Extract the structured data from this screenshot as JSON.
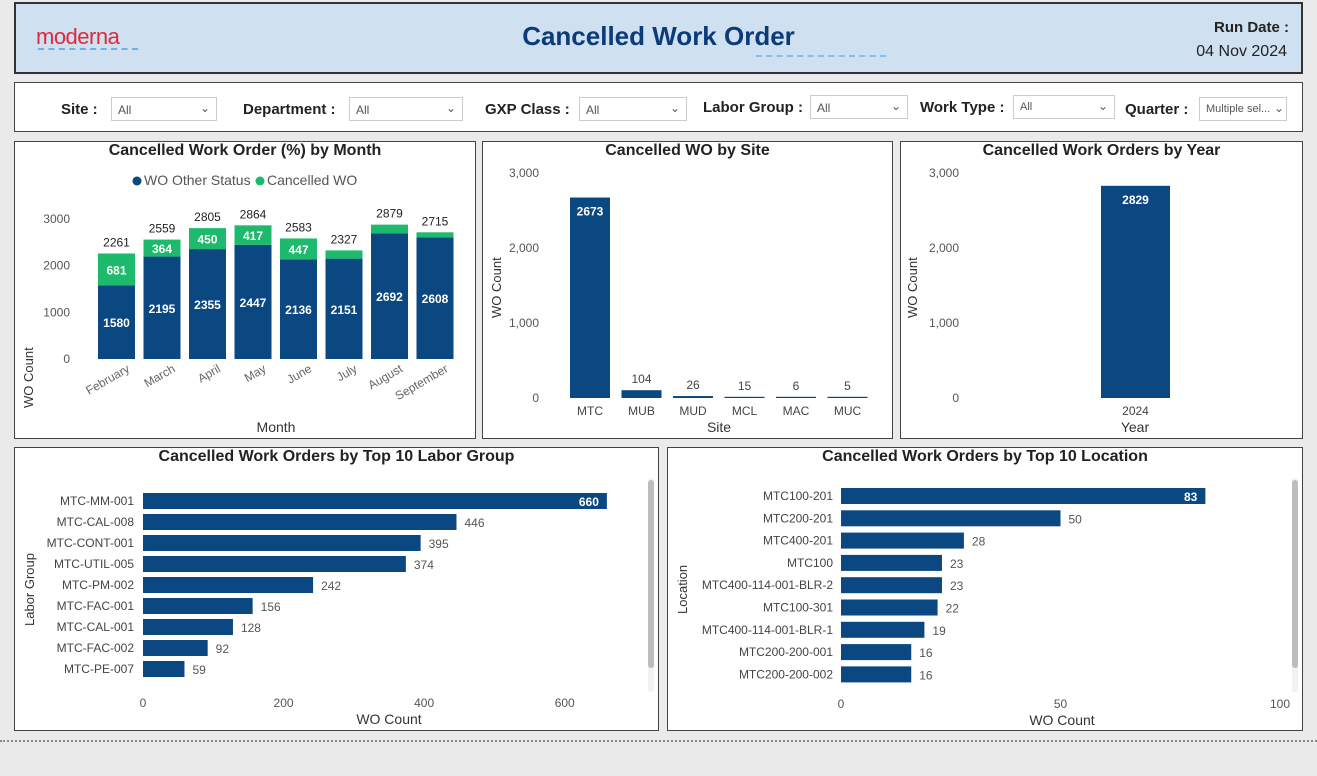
{
  "header": {
    "logo": "moderna",
    "title": "Cancelled Work Order",
    "run_date_label": "Run Date :",
    "run_date_value": "04 Nov 2024"
  },
  "filters": [
    {
      "label": "Site :",
      "value": "All"
    },
    {
      "label": "Department :",
      "value": "All"
    },
    {
      "label": "GXP Class :",
      "value": "All"
    },
    {
      "label": "Labor Group :",
      "value": "All"
    },
    {
      "label": "Work Type :",
      "value": "All"
    },
    {
      "label": "Quarter :",
      "value": "Multiple sel..."
    }
  ],
  "colors": {
    "navy": "#0b4780",
    "green": "#1db96d",
    "header_bg": "#cfe0f0",
    "title": "#0b3b78"
  },
  "chart_data": [
    {
      "type": "bar",
      "stacked": true,
      "title": "Cancelled Work Order (%) by Month",
      "xlabel": "Month",
      "ylabel": "WO Count",
      "ylim": [
        0,
        3000
      ],
      "yticks": [
        "0",
        "1000",
        "2000",
        "3000"
      ],
      "legend": "top",
      "categories": [
        "February",
        "March",
        "April",
        "May",
        "June",
        "July",
        "August",
        "September"
      ],
      "series": [
        {
          "name": "WO Other Status",
          "values": [
            1580,
            2195,
            2355,
            2447,
            2136,
            2151,
            2692,
            2608
          ],
          "labels": [
            "1580",
            "2195",
            "2355",
            "2447",
            "2136",
            "2151",
            "2692",
            "2608"
          ]
        },
        {
          "name": "Cancelled WO",
          "values": [
            681,
            364,
            450,
            417,
            447,
            176,
            187,
            107
          ],
          "labels": [
            "681",
            "364",
            "450",
            "417",
            "447",
            "",
            "",
            ""
          ]
        }
      ],
      "totals": [
        "2261",
        "2559",
        "2805",
        "2864",
        "2583",
        "2327",
        "2879",
        "2715"
      ]
    },
    {
      "type": "bar",
      "title": "Cancelled WO by Site",
      "xlabel": "Site",
      "ylabel": "WO Count",
      "ylim": [
        0,
        3000
      ],
      "yticks": [
        "0",
        "1,000",
        "2,000",
        "3,000"
      ],
      "categories": [
        "MTC",
        "MUB",
        "MUD",
        "MCL",
        "MAC",
        "MUC"
      ],
      "values": [
        2673,
        104,
        26,
        15,
        6,
        5
      ],
      "labels": [
        "2673",
        "104",
        "26",
        "15",
        "6",
        "5"
      ]
    },
    {
      "type": "bar",
      "title": "Cancelled Work Orders by Year",
      "xlabel": "Year",
      "ylabel": "WO Count",
      "ylim": [
        0,
        3000
      ],
      "yticks": [
        "0",
        "1,000",
        "2,000",
        "3,000"
      ],
      "categories": [
        "2024"
      ],
      "values": [
        2829
      ],
      "labels": [
        "2829"
      ]
    },
    {
      "type": "bar",
      "orientation": "horizontal",
      "title": "Cancelled Work Orders by Top 10 Labor Group",
      "xlabel": "WO Count",
      "ylabel": "Labor Group",
      "xlim": [
        0,
        700
      ],
      "xticks": [
        "0",
        "200",
        "400",
        "600"
      ],
      "categories": [
        "MTC-MM-001",
        "MTC-CAL-008",
        "MTC-CONT-001",
        "MTC-UTIL-005",
        "MTC-PM-002",
        "MTC-FAC-001",
        "MTC-CAL-001",
        "MTC-FAC-002",
        "MTC-PE-007"
      ],
      "values": [
        660,
        446,
        395,
        374,
        242,
        156,
        128,
        92,
        59
      ],
      "labels": [
        "660",
        "446",
        "395",
        "374",
        "242",
        "156",
        "128",
        "92",
        "59"
      ]
    },
    {
      "type": "bar",
      "orientation": "horizontal",
      "title": "Cancelled Work Orders by Top 10 Location",
      "xlabel": "WO Count",
      "ylabel": "Location",
      "xlim": [
        0,
        100
      ],
      "xticks": [
        "0",
        "50",
        "100"
      ],
      "categories": [
        "MTC100-201",
        "MTC200-201",
        "MTC400-201",
        "MTC100",
        "MTC400-114-001-BLR-2",
        "MTC100-301",
        "MTC400-114-001-BLR-1",
        "MTC200-200-001",
        "MTC200-200-002"
      ],
      "values": [
        83,
        50,
        28,
        23,
        23,
        22,
        19,
        16,
        16
      ],
      "labels": [
        "83",
        "50",
        "28",
        "23",
        "23",
        "22",
        "19",
        "16",
        "16"
      ]
    }
  ]
}
